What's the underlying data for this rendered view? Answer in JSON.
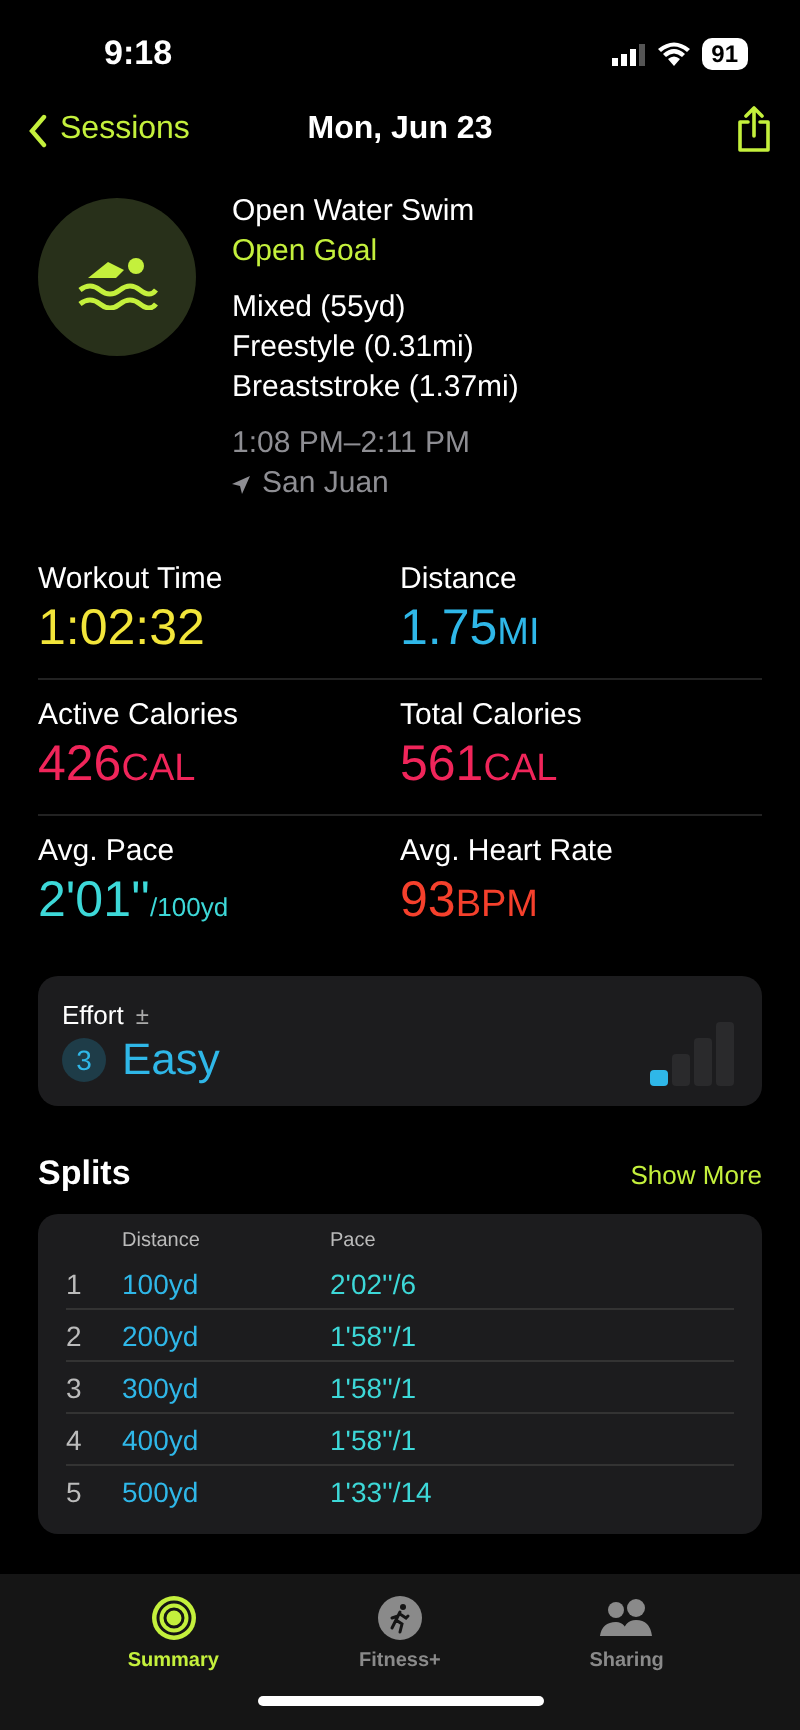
{
  "status_bar": {
    "time": "9:18",
    "battery": "91"
  },
  "nav": {
    "back": "Sessions",
    "title": "Mon, Jun 23"
  },
  "workout": {
    "name": "Open Water Swim",
    "goal": "Open Goal",
    "strokes": [
      "Mixed (55yd)",
      "Freestyle (0.31mi)",
      "Breaststroke (1.37mi)"
    ],
    "time_range": "1:08 PM–2:11 PM",
    "location": "San Juan"
  },
  "metrics": [
    {
      "label": "Workout Time",
      "value": "1:02:32",
      "color": "#f2e53a"
    },
    {
      "label": "Distance",
      "value": "1.75",
      "unit": "MI",
      "color": "#2fb7e8"
    },
    {
      "label": "Active Calories",
      "value": "426",
      "unit": "CAL",
      "color": "#f0255a"
    },
    {
      "label": "Total Calories",
      "value": "561",
      "unit": "CAL",
      "color": "#f0255a"
    },
    {
      "label": "Avg. Pace",
      "value": "2'01''",
      "unit": "/100yd",
      "color": "#3dd8d8"
    },
    {
      "label": "Avg. Heart Rate",
      "value": "93",
      "unit": "BPM",
      "color": "#f5402c"
    }
  ],
  "effort": {
    "label": "Effort",
    "adjust": "±",
    "score": "3",
    "rating": "Easy",
    "level": 0.25
  },
  "splits": {
    "title": "Splits",
    "more": "Show More",
    "columns": [
      "Distance",
      "Pace"
    ],
    "rows": [
      {
        "index": "1",
        "distance": "100yd",
        "pace": "2'02''/6"
      },
      {
        "index": "2",
        "distance": "200yd",
        "pace": "1'58''/1"
      },
      {
        "index": "3",
        "distance": "300yd",
        "pace": "1'58''/1"
      },
      {
        "index": "4",
        "distance": "400yd",
        "pace": "1'58''/1"
      },
      {
        "index": "5",
        "distance": "500yd",
        "pace": "1'33''/14"
      }
    ]
  },
  "tabs": [
    {
      "label": "Summary",
      "kind": "rings",
      "selected": true
    },
    {
      "label": "Fitness+",
      "kind": "runner",
      "selected": false
    },
    {
      "label": "Sharing",
      "kind": "people",
      "selected": false
    }
  ]
}
